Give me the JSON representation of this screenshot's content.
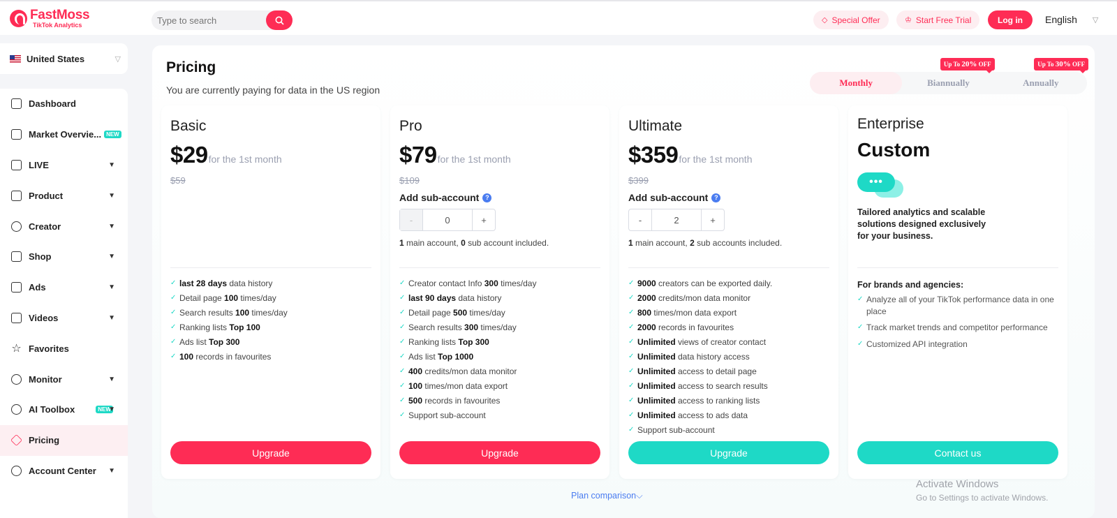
{
  "brand": {
    "name": "FastMoss",
    "tagline": "TikTok Analytics",
    "accent": "#fe2c55",
    "teal": "#1ed9c6"
  },
  "header": {
    "search_placeholder": "Type to search",
    "special_offer": "Special Offer",
    "start_trial": "Start Free Trial",
    "login": "Log in",
    "language": "English"
  },
  "sidebar": {
    "country": "United States",
    "items": [
      {
        "label": "Dashboard",
        "icon": "home-icon"
      },
      {
        "label": "Market Overvie...",
        "icon": "bar-chart-icon",
        "badge": "NEW"
      },
      {
        "label": "LIVE",
        "icon": "live-icon"
      },
      {
        "label": "Product",
        "icon": "product-icon"
      },
      {
        "label": "Creator",
        "icon": "creator-icon"
      },
      {
        "label": "Shop",
        "icon": "shop-icon"
      },
      {
        "label": "Ads",
        "icon": "ads-icon"
      },
      {
        "label": "Videos",
        "icon": "video-icon"
      },
      {
        "label": "Favorites",
        "icon": "star-icon"
      },
      {
        "label": "Monitor",
        "icon": "monitor-icon"
      },
      {
        "label": "AI Toolbox",
        "icon": "ai-icon",
        "badge": "NEW"
      },
      {
        "label": "Pricing",
        "icon": "diamond-icon"
      },
      {
        "label": "Account Center",
        "icon": "user-icon"
      }
    ]
  },
  "page": {
    "title": "Pricing",
    "subtitle": "You are currently paying for data in the US region",
    "billing": {
      "monthly": "Monthly",
      "biannually": "Biannually",
      "annually": "Annually",
      "biannual_badge_prefix": "Up To",
      "biannual_badge_value": "20%",
      "biannual_badge_suffix": "OFF",
      "annual_badge_prefix": "Up To",
      "annual_badge_value": "30%",
      "annual_badge_suffix": "OFF"
    },
    "plans": {
      "basic": {
        "name": "Basic",
        "price": "$29",
        "per": "for the 1st month",
        "old_price": "$59",
        "features": [
          {
            "b": "last 28 days",
            "t": " data history"
          },
          {
            "pre": "Detail page ",
            "b": "100",
            "t": " times/day"
          },
          {
            "pre": "Search results ",
            "b": "100",
            "t": " times/day"
          },
          {
            "pre": "Ranking lists ",
            "b": "Top 100",
            "t": ""
          },
          {
            "pre": "Ads list ",
            "b": "Top 300",
            "t": ""
          },
          {
            "b": "100",
            "t": " records in favourites"
          }
        ],
        "button": "Upgrade"
      },
      "pro": {
        "name": "Pro",
        "price": "$79",
        "per": "for the 1st month",
        "old_price": "$109",
        "sub_account_label": "Add sub-account",
        "sub_account_value": "0",
        "minus": "-",
        "plus": "+",
        "incl_main": "1",
        "incl_main_text": " main account, ",
        "incl_sub": "0",
        "incl_sub_text": " sub account included.",
        "features": [
          {
            "pre": "Creator contact Info ",
            "b": "300",
            "t": " times/day"
          },
          {
            "b": "last 90 days",
            "t": " data history"
          },
          {
            "pre": "Detail page ",
            "b": "500",
            "t": " times/day"
          },
          {
            "pre": "Search results ",
            "b": "300",
            "t": " times/day"
          },
          {
            "pre": "Ranking lists ",
            "b": "Top 300",
            "t": ""
          },
          {
            "pre": "Ads list ",
            "b": "Top 1000",
            "t": ""
          },
          {
            "b": "400",
            "t": " credits/mon data monitor"
          },
          {
            "b": "100",
            "t": " times/mon data export"
          },
          {
            "b": "500",
            "t": " records in favourites"
          },
          {
            "pre": "Support sub-account",
            "b": "",
            "t": ""
          }
        ],
        "button": "Upgrade"
      },
      "ultimate": {
        "name": "Ultimate",
        "price": "$359",
        "per": "for the 1st month",
        "old_price": "$399",
        "sub_account_label": "Add sub-account",
        "sub_account_value": "2",
        "minus": "-",
        "plus": "+",
        "incl_main": "1",
        "incl_main_text": " main account, ",
        "incl_sub": "2",
        "incl_sub_text": " sub accounts included.",
        "features": [
          {
            "b": "9000",
            "t": " creators can be exported daily."
          },
          {
            "b": "2000",
            "t": " credits/mon data monitor"
          },
          {
            "b": "800",
            "t": " times/mon data export"
          },
          {
            "b": "2000",
            "t": " records in favourites"
          },
          {
            "b": "Unlimited",
            "t": " views of creator contact"
          },
          {
            "b": "Unlimited",
            "t": " data history access"
          },
          {
            "b": "Unlimited",
            "t": " access to detail page"
          },
          {
            "b": "Unlimited",
            "t": " access to search results"
          },
          {
            "b": "Unlimited",
            "t": " access to ranking lists"
          },
          {
            "b": "Unlimited",
            "t": " access to ads data"
          },
          {
            "pre": "Support sub-account",
            "b": "",
            "t": ""
          }
        ],
        "button": "Upgrade"
      },
      "enterprise": {
        "name": "Enterprise",
        "price": "Custom",
        "chat_dots": "•••",
        "description": "Tailored analytics and scalable solutions designed exclusively for your business.",
        "brands_heading": "For brands and agencies:",
        "features": [
          "Analyze all of your TikTok performance data in one place",
          "Track market trends and competitor performance",
          "Customized API integration"
        ],
        "button": "Contact us"
      }
    },
    "plan_comparison": "Plan comparison",
    "watermark_title": "Activate Windows",
    "watermark_sub": "Go to Settings to activate Windows."
  }
}
